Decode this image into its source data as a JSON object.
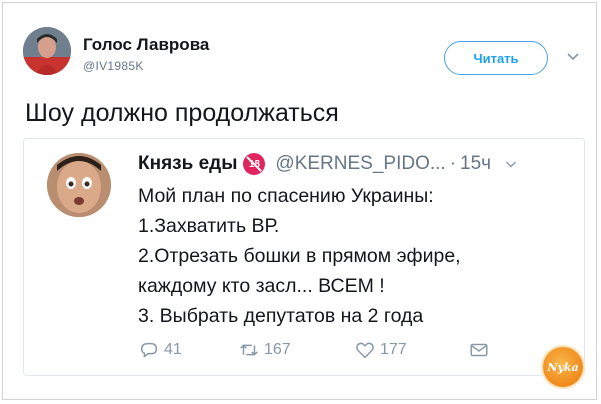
{
  "author": {
    "display_name": "Голос Лаврова",
    "handle": "@IV1985K",
    "follow_label": "Читать"
  },
  "tweet": {
    "text": "Шоу должно продолжаться"
  },
  "quoted": {
    "name": "Князь еды",
    "badge": "18",
    "handle": "@KERNES_PIDO...",
    "dot": "·",
    "time": "15ч",
    "lines": [
      "Мой план по спасению Украины:",
      "1.Захватить ВР.",
      "2.Отрезать бошки в прямом эфире,",
      "каждому кто засл... ВСЕМ !",
      "3. Выбрать депутатов на 2 года"
    ],
    "actions": {
      "replies": "41",
      "retweets": "167",
      "likes": "177"
    }
  },
  "watermark": {
    "text": "Nyka"
  },
  "colors": {
    "accent": "#1da1f2",
    "text": "#14171a",
    "muted": "#657786",
    "badge": "#e0245e"
  }
}
